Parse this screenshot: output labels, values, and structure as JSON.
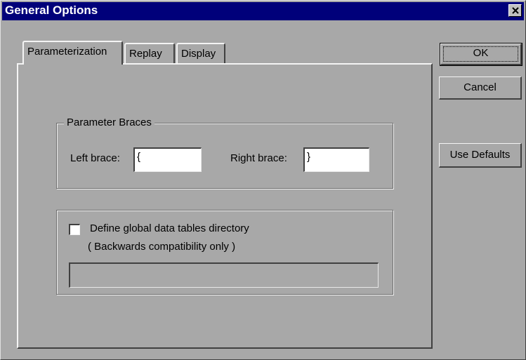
{
  "window": {
    "title": "General Options"
  },
  "tabs": [
    {
      "label": "Parameterization",
      "active": true
    },
    {
      "label": "Replay",
      "active": false
    },
    {
      "label": "Display",
      "active": false
    }
  ],
  "parameter_braces": {
    "legend": "Parameter Braces",
    "left_label": "Left brace:",
    "left_value": "{",
    "right_label": "Right brace:",
    "right_value": "}"
  },
  "data_tables": {
    "checkbox_label": "Define global data tables directory",
    "checked": false,
    "note": "( Backwards compatibility only )",
    "directory_value": ""
  },
  "buttons": {
    "ok": "OK",
    "cancel": "Cancel",
    "use_defaults": "Use Defaults"
  },
  "colors": {
    "title_bar": "#00007a",
    "dialog_face": "#a8a8a8"
  },
  "icons": {
    "close": "close-icon"
  }
}
